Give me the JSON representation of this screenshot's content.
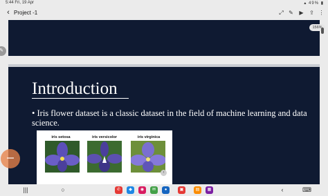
{
  "status_bar": {
    "time": "5:44",
    "date": "Fri, 19 Apr",
    "battery": "49%"
  },
  "toolbar": {
    "back_icon": "back-arrow-icon",
    "title": "Project -1",
    "icons": [
      "expand-icon",
      "edit-icon",
      "slideshow-icon",
      "share-icon",
      "more-icon"
    ]
  },
  "zoom": {
    "label": "156%"
  },
  "slide": {
    "title": "Introduction",
    "bullet": "• Iris flower dataset is a classic dataset in the field of machine learning and data science.",
    "figure": {
      "species": [
        "iris setosa",
        "iris versicolor",
        "iris virginica"
      ],
      "photo_colors": [
        "#5b4fb8",
        "#4b3f9c",
        "#7a6fd0"
      ]
    }
  },
  "nav_bar": {
    "buttons": [
      "menu-icon",
      "home-icon",
      "back-nav-icon"
    ],
    "apps": [
      {
        "name": "phone-app-icon",
        "color": "#e53935"
      },
      {
        "name": "store-app-icon",
        "color": "#1e88e5"
      },
      {
        "name": "camera-app-icon",
        "color": "#d81b60"
      },
      {
        "name": "messages-app-icon",
        "color": "#43a047"
      },
      {
        "name": "chat-app-icon",
        "color": "#1565c0"
      },
      {
        "name": "gallery-app-icon",
        "color": "#e53935"
      },
      {
        "name": "files-app-icon",
        "color": "#fb8c00"
      },
      {
        "name": "notes-app-icon",
        "color": "#7b1fa2"
      }
    ]
  }
}
